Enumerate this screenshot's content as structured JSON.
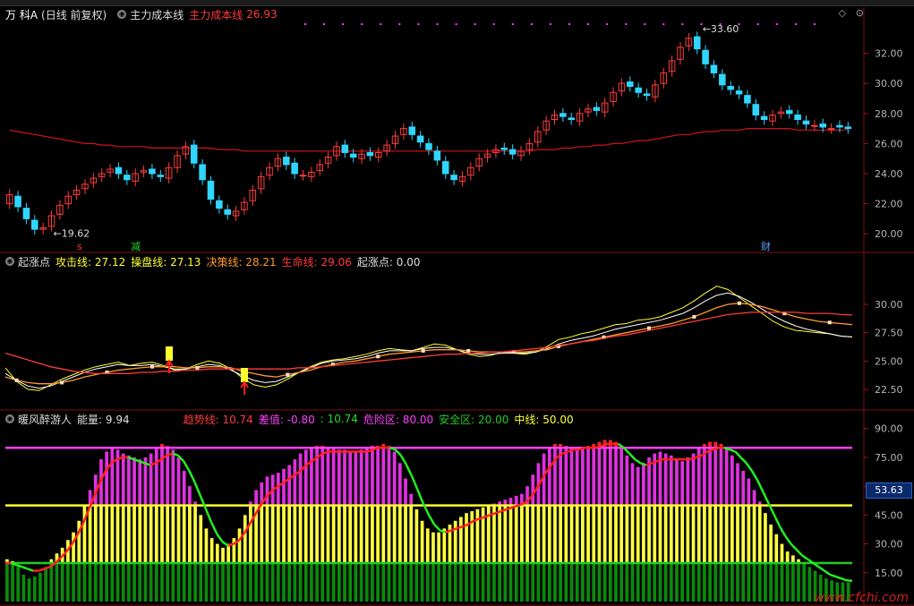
{
  "panel1": {
    "stock": "万 科A",
    "period": "(日线 前复权)",
    "indicator": "主力成本线",
    "ind_label": "主力成本线",
    "ind_value": "26.93",
    "y_ticks": [
      "32.00",
      "30.00",
      "28.00",
      "26.00",
      "24.00",
      "22.00",
      "20.00"
    ],
    "max_label": "33.60",
    "min_label": "19.62",
    "markers": {
      "s": "s",
      "jian": "减",
      "cai": "财"
    }
  },
  "panel2": {
    "name": "起涨点",
    "l1": "攻击线: 27.12",
    "l2": "操盘线: 27.13",
    "l3": "决策线: 28.21",
    "l4": "生命线: 29.06",
    "l5": "起涨点: 0.00",
    "y_ticks": [
      "30.00",
      "27.50",
      "25.00",
      "22.50"
    ]
  },
  "panel3": {
    "name": "暖风醉游人",
    "energy": "能量: 9.94",
    "trend": "趋势线: 10.74",
    "diff": "差值: -0.80",
    "colon": ": 10.74",
    "danger": "危险区: 80.00",
    "safe": "安全区: 20.00",
    "mid": "中线: 50.00",
    "y_ticks": [
      "90.00",
      "75.00",
      "60.00",
      "45.00",
      "30.00",
      "15.00"
    ],
    "current": "53.63"
  },
  "watermark": "www.cfchi.com",
  "colors": {
    "up": "#ff3b3b",
    "down": "#2fd6ff",
    "ma": "#d01414",
    "magenta": "#ff40ff",
    "yellow": "#ffff30",
    "green": "#22cc22",
    "dkgreen": "#0b7a0b"
  },
  "chart_data": [
    {
      "type": "candlestick",
      "ylim": [
        19,
        34
      ],
      "close": [
        22.6,
        21.8,
        21.0,
        20.3,
        20.4,
        21.2,
        21.9,
        22.5,
        22.9,
        23.3,
        23.7,
        24.0,
        24.3,
        24.0,
        23.6,
        24.0,
        24.2,
        24.0,
        23.8,
        24.4,
        25.2,
        25.8,
        24.7,
        23.6,
        22.3,
        21.7,
        21.3,
        21.5,
        22.1,
        22.9,
        23.8,
        24.4,
        25.0,
        24.6,
        24.0,
        23.9,
        24.1,
        24.6,
        25.1,
        25.8,
        25.4,
        25.1,
        25.3,
        25.2,
        25.4,
        25.9,
        26.5,
        27.0,
        26.6,
        26.1,
        25.6,
        24.9,
        24.0,
        23.6,
        23.8,
        24.4,
        25.0,
        25.3,
        25.6,
        25.6,
        25.3,
        25.5,
        26.0,
        26.8,
        27.5,
        27.9,
        27.8,
        27.6,
        28.0,
        28.3,
        28.2,
        28.7,
        29.4,
        30.0,
        29.8,
        29.4,
        29.2,
        29.9,
        30.7,
        31.5,
        32.4,
        33.0,
        32.3,
        31.3,
        30.7,
        29.9,
        29.6,
        29.3,
        28.7,
        27.9,
        27.6,
        27.9,
        28.1,
        28.0,
        27.6,
        27.3,
        27.2,
        27.1,
        27.0,
        27.1,
        27.0
      ],
      "open": [
        22.0,
        22.5,
        21.7,
        20.9,
        20.3,
        20.5,
        21.3,
        22.0,
        22.6,
        23.0,
        23.4,
        23.8,
        24.1,
        24.4,
        23.9,
        23.5,
        24.1,
        24.3,
        23.9,
        23.7,
        24.4,
        25.3,
        25.9,
        24.6,
        23.5,
        22.2,
        21.6,
        21.2,
        21.6,
        22.2,
        23.0,
        23.9,
        24.5,
        25.1,
        24.7,
        23.9,
        23.8,
        24.2,
        24.7,
        25.2,
        25.9,
        25.3,
        25.0,
        25.4,
        25.1,
        25.5,
        26.0,
        26.6,
        27.1,
        26.5,
        26.0,
        25.5,
        24.8,
        23.9,
        23.5,
        23.9,
        24.5,
        25.1,
        25.4,
        25.7,
        25.6,
        25.2,
        25.6,
        26.1,
        26.9,
        27.6,
        28.0,
        27.7,
        27.5,
        28.1,
        28.4,
        28.1,
        28.8,
        29.5,
        30.1,
        29.7,
        29.3,
        29.1,
        30.0,
        30.8,
        31.6,
        32.5,
        33.1,
        32.2,
        31.2,
        30.6,
        29.8,
        29.5,
        29.2,
        28.6,
        27.8,
        27.5,
        28.0,
        28.2,
        27.9,
        27.5,
        27.2,
        27.3,
        27.0,
        27.2,
        27.1
      ],
      "ma": [
        26.9,
        26.8,
        26.7,
        26.6,
        26.5,
        26.4,
        26.3,
        26.2,
        26.1,
        26.0,
        26.0,
        25.9,
        25.9,
        25.8,
        25.8,
        25.8,
        25.8,
        25.7,
        25.7,
        25.7,
        25.7,
        25.7,
        25.7,
        25.7,
        25.7,
        25.6,
        25.6,
        25.6,
        25.5,
        25.5,
        25.5,
        25.5,
        25.5,
        25.5,
        25.5,
        25.5,
        25.5,
        25.5,
        25.5,
        25.5,
        25.5,
        25.5,
        25.5,
        25.5,
        25.5,
        25.5,
        25.5,
        25.5,
        25.5,
        25.5,
        25.5,
        25.5,
        25.5,
        25.5,
        25.5,
        25.5,
        25.5,
        25.5,
        25.5,
        25.5,
        25.5,
        25.5,
        25.5,
        25.6,
        25.6,
        25.6,
        25.7,
        25.7,
        25.8,
        25.8,
        25.9,
        25.9,
        26.0,
        26.0,
        26.1,
        26.2,
        26.2,
        26.3,
        26.4,
        26.5,
        26.6,
        26.6,
        26.7,
        26.8,
        26.8,
        26.9,
        26.9,
        26.9,
        27.0,
        27.0,
        27.0,
        27.0,
        27.0,
        27.0,
        26.9,
        26.9,
        26.9,
        26.9,
        26.9,
        26.9,
        26.93
      ]
    },
    {
      "type": "line",
      "ylim": [
        21,
        33
      ],
      "series": [
        {
          "name": "攻击线",
          "values": [
            24.4,
            23.2,
            22.5,
            22.4,
            22.9,
            23.4,
            23.8,
            24.2,
            24.5,
            24.7,
            24.9,
            24.6,
            24.8,
            24.9,
            24.6,
            24.2,
            24.3,
            24.7,
            25.0,
            24.8,
            24.3,
            23.5,
            22.9,
            22.7,
            22.9,
            23.4,
            24.0,
            24.5,
            24.9,
            25.1,
            25.2,
            25.4,
            25.6,
            25.9,
            26.1,
            26.0,
            25.9,
            26.2,
            26.5,
            26.4,
            26.0,
            25.6,
            25.4,
            25.5,
            25.8,
            25.7,
            25.6,
            25.8,
            26.3,
            26.9,
            27.1,
            27.4,
            27.6,
            27.9,
            28.2,
            28.3,
            28.6,
            28.7,
            28.9,
            29.3,
            29.7,
            30.3,
            31.0,
            31.6,
            31.3,
            30.6,
            29.9,
            29.2,
            28.5,
            28.0,
            27.7,
            27.6,
            27.5,
            27.4,
            27.2,
            27.12
          ]
        },
        {
          "name": "操盘线",
          "values": [
            23.9,
            23.3,
            22.8,
            22.6,
            22.8,
            23.2,
            23.6,
            24.0,
            24.3,
            24.5,
            24.7,
            24.6,
            24.6,
            24.7,
            24.5,
            24.3,
            24.3,
            24.5,
            24.7,
            24.6,
            24.2,
            23.7,
            23.3,
            23.1,
            23.2,
            23.6,
            24.0,
            24.4,
            24.8,
            25.0,
            25.1,
            25.2,
            25.4,
            25.7,
            25.9,
            25.9,
            25.9,
            26.1,
            26.2,
            26.2,
            26.0,
            25.7,
            25.6,
            25.6,
            25.7,
            25.7,
            25.7,
            25.8,
            26.1,
            26.5,
            26.8,
            27.0,
            27.2,
            27.5,
            27.8,
            28.0,
            28.2,
            28.4,
            28.6,
            28.9,
            29.2,
            29.7,
            30.3,
            30.8,
            31.0,
            30.7,
            30.2,
            29.6,
            29.0,
            28.5,
            28.1,
            27.8,
            27.6,
            27.4,
            27.2,
            27.13
          ]
        },
        {
          "name": "决策线",
          "values": [
            23.6,
            23.3,
            23.1,
            23.0,
            23.0,
            23.1,
            23.3,
            23.6,
            23.8,
            24.0,
            24.2,
            24.3,
            24.4,
            24.5,
            24.5,
            24.5,
            24.4,
            24.4,
            24.5,
            24.5,
            24.4,
            24.1,
            23.9,
            23.7,
            23.6,
            23.8,
            24.0,
            24.2,
            24.5,
            24.7,
            24.9,
            25.0,
            25.2,
            25.4,
            25.6,
            25.7,
            25.8,
            25.9,
            26.0,
            26.0,
            26.0,
            25.9,
            25.8,
            25.8,
            25.8,
            25.8,
            25.8,
            25.9,
            26.0,
            26.3,
            26.5,
            26.7,
            26.9,
            27.1,
            27.3,
            27.5,
            27.7,
            27.9,
            28.1,
            28.3,
            28.6,
            28.9,
            29.3,
            29.7,
            30.0,
            30.1,
            30.0,
            29.8,
            29.5,
            29.2,
            28.9,
            28.7,
            28.5,
            28.4,
            28.3,
            28.21
          ]
        },
        {
          "name": "生命线",
          "values": [
            25.7,
            25.4,
            25.1,
            24.8,
            24.5,
            24.3,
            24.1,
            24.0,
            23.9,
            23.9,
            23.9,
            23.9,
            24.0,
            24.0,
            24.1,
            24.1,
            24.2,
            24.2,
            24.3,
            24.3,
            24.3,
            24.3,
            24.3,
            24.3,
            24.3,
            24.3,
            24.4,
            24.4,
            24.5,
            24.6,
            24.7,
            24.8,
            24.9,
            25.0,
            25.1,
            25.2,
            25.3,
            25.4,
            25.5,
            25.6,
            25.6,
            25.7,
            25.7,
            25.8,
            25.8,
            25.9,
            26.0,
            26.1,
            26.2,
            26.4,
            26.5,
            26.7,
            26.8,
            27.0,
            27.2,
            27.3,
            27.5,
            27.7,
            27.9,
            28.1,
            28.3,
            28.5,
            28.7,
            28.9,
            29.1,
            29.2,
            29.3,
            29.3,
            29.3,
            29.3,
            29.3,
            29.2,
            29.2,
            29.2,
            29.1,
            29.06
          ]
        }
      ]
    },
    {
      "type": "bar",
      "ylim": [
        0,
        95
      ],
      "series": [
        {
          "name": "能量",
          "values": [
            22,
            21,
            18,
            14,
            12,
            13,
            15,
            18,
            22,
            25,
            28,
            32,
            36,
            42,
            50,
            58,
            66,
            74,
            78,
            80,
            79,
            77,
            76,
            75,
            74,
            75,
            77,
            80,
            82,
            81,
            79,
            75,
            68,
            60,
            52,
            45,
            38,
            33,
            30,
            28,
            30,
            33,
            38,
            45,
            52,
            58,
            62,
            65,
            66,
            67,
            69,
            71,
            74,
            77,
            79,
            80,
            81,
            81,
            80,
            80,
            79,
            79,
            78,
            78,
            79,
            80,
            81,
            81,
            82,
            81,
            78,
            72,
            64,
            56,
            48,
            42,
            38,
            36,
            36,
            38,
            40,
            42,
            44,
            46,
            47,
            48,
            49,
            50,
            51,
            52,
            53,
            54,
            55,
            56,
            60,
            66,
            72,
            77,
            80,
            82,
            82,
            81,
            80,
            80,
            80,
            81,
            82,
            83,
            84,
            84,
            83,
            80,
            76,
            72,
            70,
            72,
            75,
            77,
            78,
            77,
            76,
            74,
            73,
            75,
            77,
            80,
            82,
            83,
            83,
            82,
            80,
            76,
            72,
            68,
            64,
            58,
            52,
            46,
            40,
            35,
            30,
            26,
            24,
            22,
            20,
            18,
            16,
            14,
            12,
            11,
            10,
            10,
            9.94
          ]
        },
        {
          "name": "趋势线",
          "values": [
            20,
            20,
            19,
            18,
            17,
            16,
            16,
            17,
            18,
            20,
            23,
            26,
            30,
            35,
            41,
            48,
            55,
            62,
            68,
            72,
            74,
            75,
            75,
            74,
            73,
            72,
            71,
            72,
            74,
            76,
            77,
            76,
            73,
            68,
            62,
            55,
            48,
            41,
            35,
            31,
            29,
            30,
            32,
            36,
            41,
            46,
            51,
            55,
            58,
            60,
            62,
            64,
            66,
            68,
            71,
            73,
            75,
            77,
            78,
            78,
            78,
            78,
            78,
            78,
            78,
            78,
            79,
            80,
            80,
            80,
            79,
            76,
            71,
            65,
            58,
            51,
            45,
            40,
            37,
            36,
            37,
            38,
            39,
            40,
            42,
            43,
            44,
            45,
            46,
            47,
            48,
            49,
            50,
            51,
            53,
            57,
            62,
            67,
            71,
            75,
            77,
            78,
            79,
            79,
            80,
            80,
            80,
            81,
            82,
            82,
            82,
            80,
            77,
            74,
            72,
            71,
            72,
            73,
            74,
            74,
            74,
            74,
            74,
            74,
            75,
            76,
            78,
            79,
            80,
            80,
            79,
            78,
            75,
            72,
            68,
            63,
            57,
            51,
            45,
            39,
            34,
            30,
            27,
            24,
            22,
            20,
            18,
            16,
            14,
            13,
            12,
            11,
            10.74
          ]
        }
      ],
      "thresholds": {
        "危险区": 80,
        "中线": 50,
        "安全区": 20
      }
    }
  ]
}
